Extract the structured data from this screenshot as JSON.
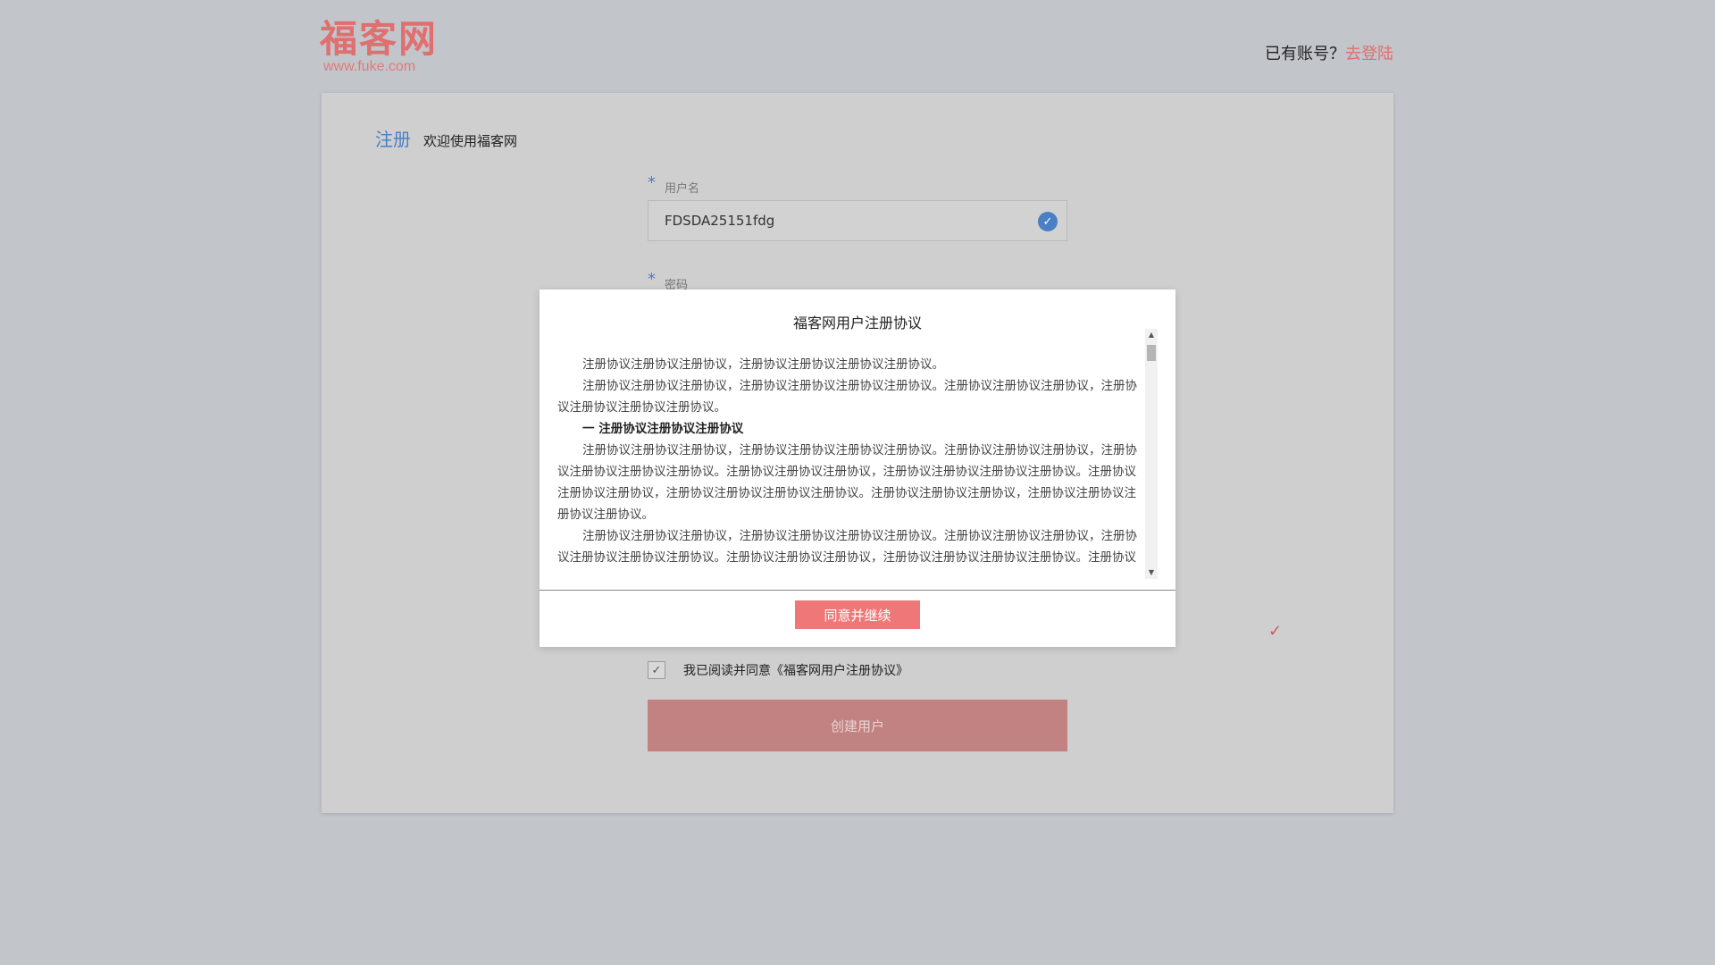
{
  "header": {
    "logo_title": "福客网",
    "logo_url": "www.fuke.com",
    "login_prompt": "已有账号？",
    "login_link": "去登陆"
  },
  "form": {
    "title": "注册",
    "subtitle": "欢迎使用福客网",
    "required_mark": "*",
    "username_label": "用户名",
    "username_value": "FDSDA25151fdg",
    "password_label": "密码",
    "agree_text": "我已阅读并同意《福客网用户注册协议》",
    "create_button": "创建用户"
  },
  "modal": {
    "title": "福客网用户注册协议",
    "paragraphs": [
      "注册协议注册协议注册协议，注册协议注册协议注册协议注册协议。",
      "注册协议注册协议注册协议，注册协议注册协议注册协议注册协议。注册协议注册协议注册协议，注册协议注册协议注册协议注册协议。",
      "一 注册协议注册协议注册协议",
      "注册协议注册协议注册协议，注册协议注册协议注册协议注册协议。注册协议注册协议注册协议，注册协议注册协议注册协议注册协议。注册协议注册协议注册协议，注册协议注册协议注册协议注册协议。注册协议注册协议注册协议，注册协议注册协议注册协议注册协议。注册协议注册协议注册协议，注册协议注册协议注册协议注册协议。",
      "注册协议注册协议注册协议，注册协议注册协议注册协议注册协议。注册协议注册协议注册协议，注册协议注册协议注册协议注册协议。注册协议注册协议注册协议，注册协议注册协议注册协议注册协议。注册协议注册协议注册协议，注册协议注册协议注册协议注册协议。注册协议注册协议注册协议，注册协议注册协议注册协议注册协议。"
    ],
    "agree_button": "同意并继续"
  },
  "icons": {
    "username_valid": "check-circle-icon",
    "field_valid": "check-icon",
    "checkbox": "checkmark-icon"
  },
  "colors": {
    "accent_red": "#e06f6f",
    "accent_blue": "#4a7fc4",
    "modal_button": "#f07777",
    "create_button": "#c38282"
  }
}
